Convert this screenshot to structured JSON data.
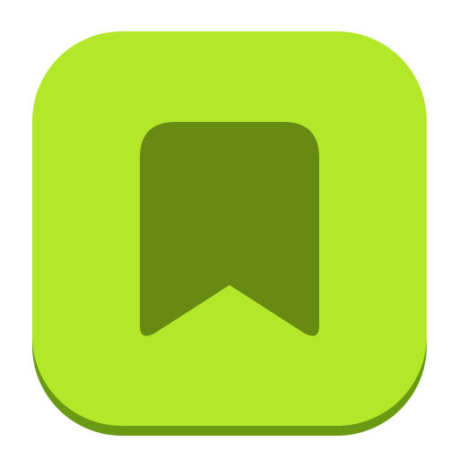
{
  "icon": {
    "name": "bookmark-icon",
    "colors": {
      "tile_face": "#b3e82a",
      "tile_shadow": "#6a9a14",
      "glyph": "#678b12"
    }
  }
}
